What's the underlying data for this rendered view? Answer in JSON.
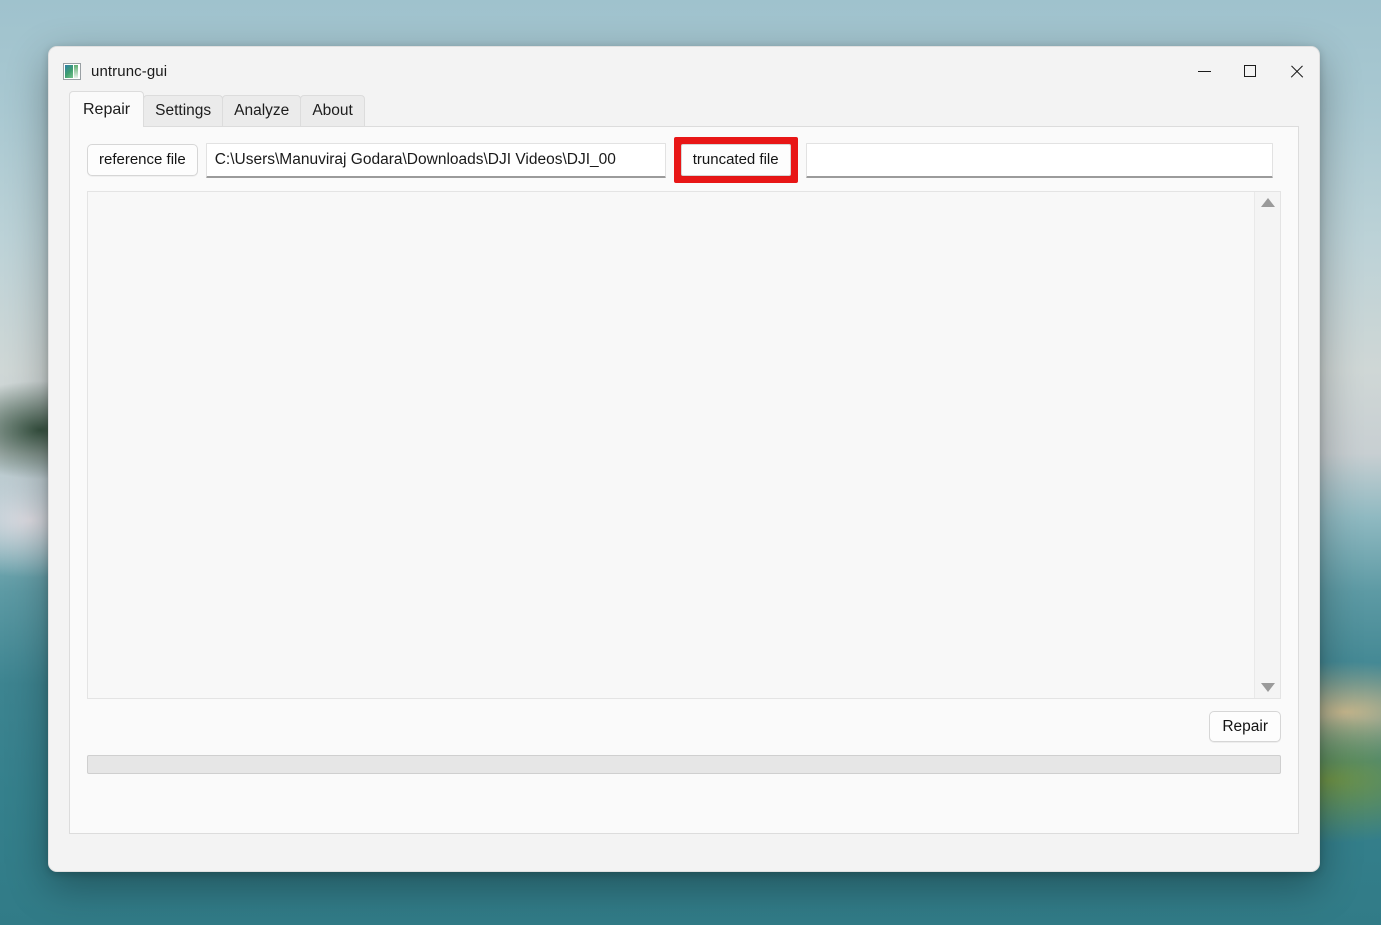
{
  "window": {
    "title": "untrunc-gui",
    "icon": "app-image-icon",
    "controls": {
      "minimize": "minimize-icon",
      "maximize": "maximize-icon",
      "close": "close-icon"
    }
  },
  "tabs": [
    {
      "label": "Repair",
      "active": true
    },
    {
      "label": "Settings",
      "active": false
    },
    {
      "label": "Analyze",
      "active": false
    },
    {
      "label": "About",
      "active": false
    }
  ],
  "repair_tab": {
    "reference_file": {
      "button_label": "reference file",
      "value": "C:\\Users\\Manuviraj Godara\\Downloads\\DJI Videos\\DJI_00",
      "placeholder": ""
    },
    "truncated_file": {
      "button_label": "truncated file",
      "value": "",
      "placeholder": "",
      "highlighted": true,
      "highlight_color": "#e81616"
    },
    "log": {
      "text": "",
      "scrollbar": {
        "up_arrow": "scroll-up-arrow-icon",
        "down_arrow": "scroll-down-arrow-icon"
      }
    },
    "repair_button_label": "Repair",
    "progress": {
      "percent": 0,
      "label": ""
    }
  }
}
